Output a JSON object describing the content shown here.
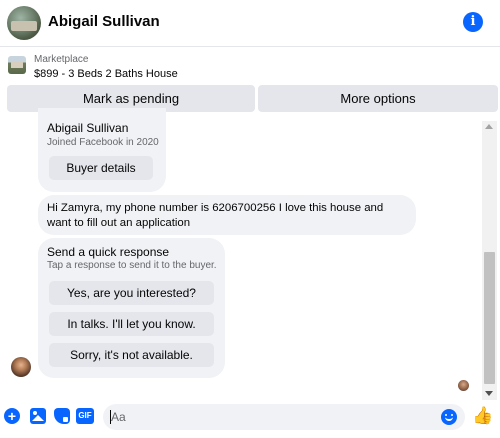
{
  "header": {
    "contact_name": "Abigail Sullivan",
    "info_icon_glyph": "i"
  },
  "listing": {
    "category": "Marketplace",
    "title": "$899 - 3 Beds 2 Baths House"
  },
  "actions": {
    "mark_pending": "Mark as pending",
    "more_options": "More options"
  },
  "messages": {
    "buyer_card": {
      "name": "Abigail Sullivan",
      "joined": "Joined Facebook in 2020",
      "details_button": "Buyer details"
    },
    "buyer_message": "Hi Zamyra, my phone number is 6206700256 I love this house and want to fill out an application",
    "quick_response": {
      "title": "Send a quick response",
      "subtitle": "Tap a response to send it to the buyer.",
      "options": [
        "Yes, are you interested?",
        "In talks. I'll let you know.",
        "Sorry, it's not available."
      ]
    }
  },
  "composer": {
    "placeholder": "Aa",
    "gif_label": "GIF",
    "plus_glyph": "+",
    "like_glyph": "👍"
  },
  "colors": {
    "accent": "#0866ff",
    "bubble": "#f0f2f5",
    "button": "#e4e6eb"
  },
  "icons": [
    "info-icon",
    "plus-icon",
    "photo-icon",
    "sticker-icon",
    "gif-icon",
    "emoji-icon",
    "like-icon"
  ]
}
